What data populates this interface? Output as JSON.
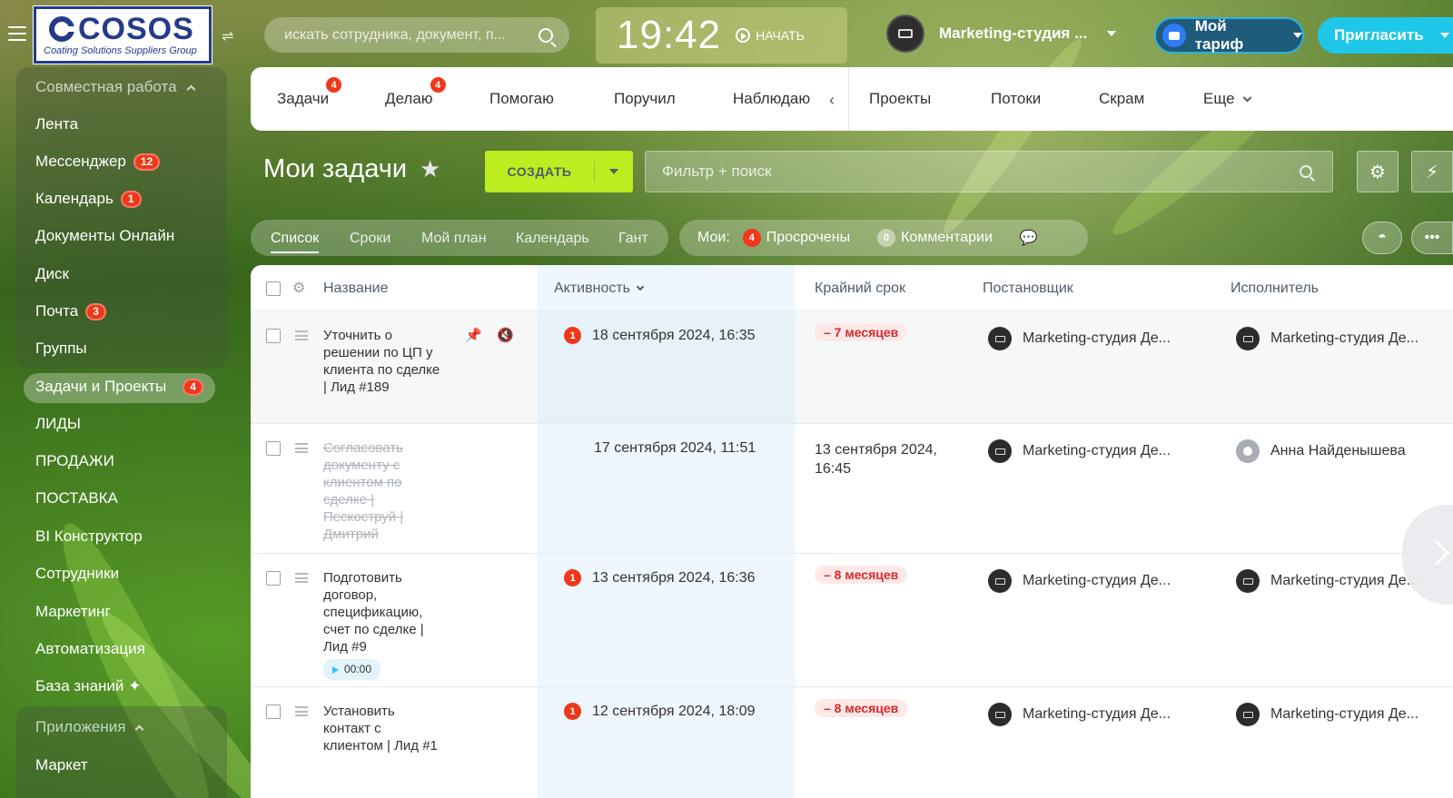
{
  "header": {
    "logo_text": "COSOS",
    "logo_sub": "Coating Solutions Suppliers Group",
    "search_placeholder": "искать сотрудника, документ, п...",
    "clock": "19:42",
    "start_label": "НАЧАТЬ",
    "company_name": "Marketing-студия ...",
    "tariff_label": "Мой тариф",
    "invite_label": "Пригласить"
  },
  "sidebar": {
    "group1_header": "Совместная работа",
    "items": [
      {
        "label": "Лента"
      },
      {
        "label": "Мессенджер",
        "badge": "12"
      },
      {
        "label": "Календарь",
        "badge": "1"
      },
      {
        "label": "Документы Онлайн"
      },
      {
        "label": "Диск"
      },
      {
        "label": "Почта",
        "badge": "3"
      },
      {
        "label": "Группы"
      }
    ],
    "active": {
      "label": "Задачи и Проекты",
      "badge": "4"
    },
    "items2": [
      {
        "label": "ЛИДЫ"
      },
      {
        "label": "ПРОДАЖИ"
      },
      {
        "label": "ПОСТАВКА"
      },
      {
        "label": "BI Конструктор"
      },
      {
        "label": "Сотрудники"
      },
      {
        "label": "Маркетинг"
      },
      {
        "label": "Автоматизация"
      },
      {
        "label": "База знаний ✦"
      }
    ],
    "group2_header": "Приложения",
    "items3": [
      {
        "label": "Маркет"
      }
    ]
  },
  "tabs": {
    "items": [
      {
        "label": "Задачи",
        "badge": "4"
      },
      {
        "label": "Делаю",
        "badge": "4"
      },
      {
        "label": "Помогаю"
      },
      {
        "label": "Поручил"
      },
      {
        "label": "Наблюдаю"
      },
      {
        "label": "Проекты"
      },
      {
        "label": "Потоки"
      },
      {
        "label": "Скрам"
      },
      {
        "label": "Еще"
      }
    ]
  },
  "toolbar": {
    "title": "Мои задачи",
    "create_label": "СОЗДАТЬ",
    "filter_placeholder": "Фильтр + поиск"
  },
  "views": {
    "items": [
      "Список",
      "Сроки",
      "Мой план",
      "Календарь",
      "Гант"
    ],
    "active": "Список"
  },
  "counters": {
    "label": "Мои:",
    "overdue_count": "4",
    "overdue_label": "Просрочены",
    "comments_count": "0",
    "comments_label": "Комментарии"
  },
  "table": {
    "columns": [
      "Название",
      "Активность",
      "Крайний срок",
      "Постановщик",
      "Исполнитель"
    ],
    "rows": [
      {
        "name": "Уточнить о решении по ЦП у клиента по сделке | Лид #189",
        "done": false,
        "activity_badge": "1",
        "activity": "18 сентября 2024, 16:35",
        "deadline": "– 7 месяцев",
        "deadline_overdue": true,
        "creator": "Marketing-студия Де...",
        "assignee": "Marketing-студия Де..."
      },
      {
        "name": "Согласовать документу с клиентом по сделке | Пескоструй | Дмитрий",
        "done": true,
        "activity_badge": "",
        "activity": "17 сентября 2024, 11:51",
        "deadline": "13 сентября 2024, 16:45",
        "deadline_overdue": false,
        "creator": "Marketing-студия Де...",
        "assignee": "Анна Найденышева"
      },
      {
        "name": "Подготовить договор, спецификацию, счет по сделке | Лид #9",
        "done": false,
        "timer": "00:00",
        "activity_badge": "1",
        "activity": "13 сентября 2024, 16:36",
        "deadline": "– 8 месяцев",
        "deadline_overdue": true,
        "creator": "Marketing-студия Де...",
        "assignee": "Marketing-студия Де..."
      },
      {
        "name": "Установить контакт с клиентом | Лид #1",
        "done": false,
        "activity_badge": "1",
        "activity": "12 сентября 2024, 18:09",
        "deadline": "– 8 месяцев",
        "deadline_overdue": true,
        "creator": "Marketing-студия Де...",
        "assignee": "Marketing-студия Де..."
      }
    ]
  },
  "colors": {
    "accent_green": "#bbed21",
    "badge_red": "#f0371a",
    "invite_blue": "#1ec6e8"
  }
}
